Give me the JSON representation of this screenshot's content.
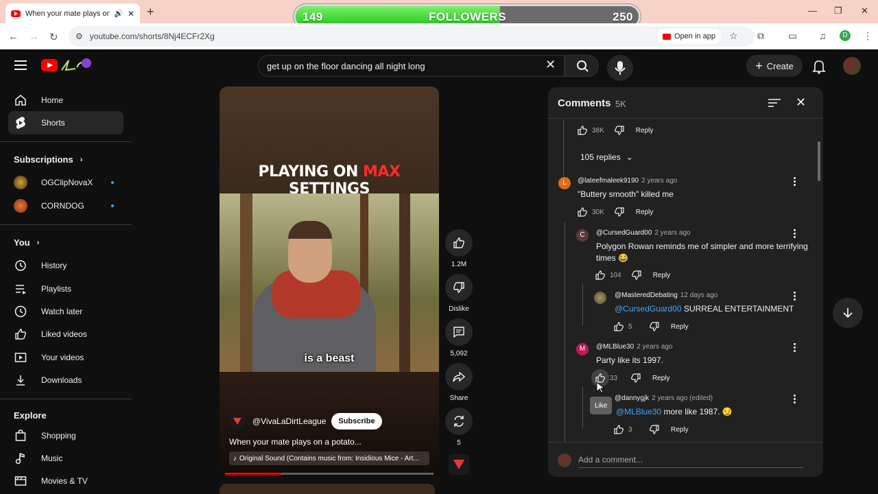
{
  "browser": {
    "tab_title": "When your mate plays on a potato...",
    "url": "youtube.com/shorts/8Nj4ECFr2Xg",
    "open_in_app": "Open in app",
    "profile_initial": "D"
  },
  "overlay": {
    "followers_current": "149",
    "followers_label": "FOLLOWERS",
    "followers_goal": "250",
    "fill_fraction": 0.596
  },
  "header": {
    "search_query": "get up on the floor dancing all night long",
    "create_label": "Create"
  },
  "sidebar": {
    "home": "Home",
    "shorts": "Shorts",
    "subscriptions": "Subscriptions",
    "channels": [
      "OGClipNovaX",
      "CORNDOG"
    ],
    "you": "You",
    "history": "History",
    "playlists": "Playlists",
    "watch_later": "Watch later",
    "liked_videos": "Liked videos",
    "your_videos": "Your videos",
    "downloads": "Downloads",
    "explore": "Explore",
    "shopping": "Shopping",
    "music": "Music",
    "movies_tv": "Movies & TV"
  },
  "short": {
    "headline_pre": "PLAYING ON ",
    "headline_max": "MAX",
    "headline_post": " SETTINGS",
    "caption": "is a beast",
    "channel": "@VivaLaDirtLeague",
    "subscribe": "Subscribe",
    "title": "When your mate plays on a potato...",
    "sound": "Original Sound (Contains music from: Insidious Mice - Art...",
    "progress_fraction": 0.27,
    "likes": "1.2M",
    "dislike_label": "Dislike",
    "comments_count": "5,092",
    "share_label": "Share",
    "remix_count": "5"
  },
  "comments": {
    "title": "Comments",
    "count": "5K",
    "top": {
      "likes": "38K",
      "reply": "Reply"
    },
    "replies_toggle": "105 replies",
    "c1": {
      "initial": "L",
      "author": "@lateefmaleek9190",
      "time": "2 years ago",
      "text": "\"Buttery smooth\" killed me",
      "likes": "30K",
      "reply": "Reply"
    },
    "c2": {
      "initial": "C",
      "author": "@CursedGuard00",
      "time": "2 years ago",
      "text": "Polygon Rowan reminds me of simpler and more terrifying times 😂",
      "likes": "104",
      "reply": "Reply"
    },
    "c3": {
      "author": "@MasteredDebating",
      "time": "12 days ago",
      "mention": "@CursedGuard00",
      "text": " SURREAL ENTERTAINMENT",
      "likes": "5",
      "reply": "Reply"
    },
    "c4": {
      "initial": "M",
      "author": "@MLBlue30",
      "time": "2 years ago",
      "text": "Party like  its 1997.",
      "likes": "33",
      "reply": "Reply"
    },
    "c5": {
      "author": "@dannygjk",
      "time": "2 years ago (edited)",
      "mention": "@MLBlue30",
      "text": " more like 1987. 😏",
      "likes": "3",
      "reply": "Reply"
    },
    "tooltip": "Like",
    "add_placeholder": "Add a comment..."
  },
  "colors": {
    "accent_red": "#ff0000",
    "link_blue": "#3ea6ff",
    "follower_green": "#21c51a"
  }
}
